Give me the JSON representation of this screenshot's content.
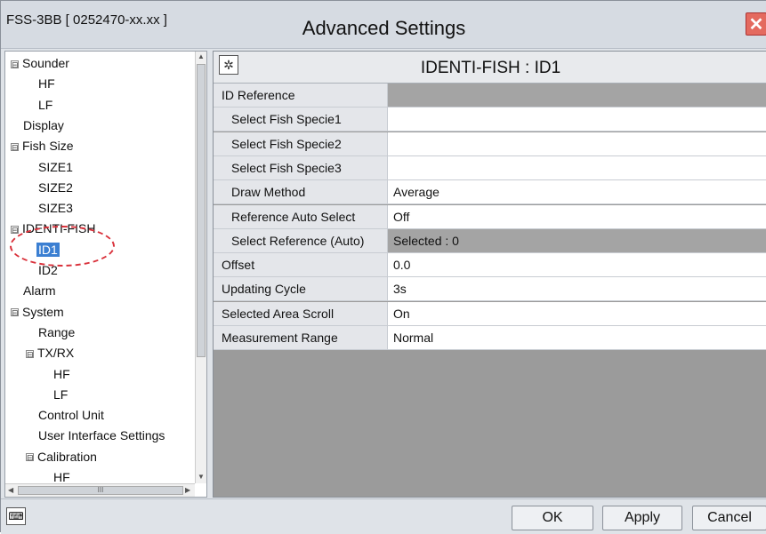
{
  "window": {
    "app_id": "FSS-3BB [ 0252470-xx.xx ]",
    "title": "Advanced Settings",
    "close_glyph": "✕"
  },
  "tree": {
    "items": [
      {
        "label": "Sounder",
        "expander": "⊟"
      },
      {
        "label": "HF"
      },
      {
        "label": "LF"
      },
      {
        "label": "Display"
      },
      {
        "label": "Fish Size",
        "expander": "⊟"
      },
      {
        "label": "SIZE1"
      },
      {
        "label": "SIZE2"
      },
      {
        "label": "SIZE3"
      },
      {
        "label": "IDENTI-FISH",
        "expander": "⊟"
      },
      {
        "label": "ID1",
        "selected": true
      },
      {
        "label": "ID2"
      },
      {
        "label": "Alarm"
      },
      {
        "label": "System",
        "expander": "⊟"
      },
      {
        "label": "Range"
      },
      {
        "label": "TX/RX",
        "expander": "⊟"
      },
      {
        "label": "HF"
      },
      {
        "label": "LF"
      },
      {
        "label": "Control Unit"
      },
      {
        "label": "User Interface Settings"
      },
      {
        "label": "Calibration",
        "expander": "⊟"
      },
      {
        "label": "HF"
      }
    ],
    "scroll_mid": "III"
  },
  "panel": {
    "title": "IDENTI-FISH : ID1",
    "icon": "settings-icon"
  },
  "settings": [
    {
      "label": "ID Reference",
      "value": "",
      "indent": false,
      "gray": true
    },
    {
      "label": "Select Fish Specie1",
      "value": "",
      "indent": true
    },
    {
      "label": "Select Fish Specie2",
      "value": "",
      "indent": true
    },
    {
      "label": "Select Fish Specie3",
      "value": "",
      "indent": true
    },
    {
      "label": "Draw Method",
      "value": "Average",
      "indent": true
    },
    {
      "label": "Reference Auto Select",
      "value": "Off",
      "indent": true
    },
    {
      "label": "Select Reference (Auto)",
      "value": "Selected : 0",
      "indent": true,
      "gray": true
    },
    {
      "label": "Offset",
      "value": "0.0",
      "indent": false
    },
    {
      "label": "Updating Cycle",
      "value": "3s",
      "indent": false
    },
    {
      "label": "Selected Area Scroll",
      "value": "On",
      "indent": false
    },
    {
      "label": "Measurement Range",
      "value": "Normal",
      "indent": false
    }
  ],
  "footer": {
    "ok": "OK",
    "apply": "Apply",
    "cancel": "Cancel",
    "keyboard_icon": "keyboard-icon"
  },
  "colors": {
    "selection": "#3b7fd2",
    "highlight_ring": "#d9303a",
    "panel_bg": "#9b9b9b"
  }
}
